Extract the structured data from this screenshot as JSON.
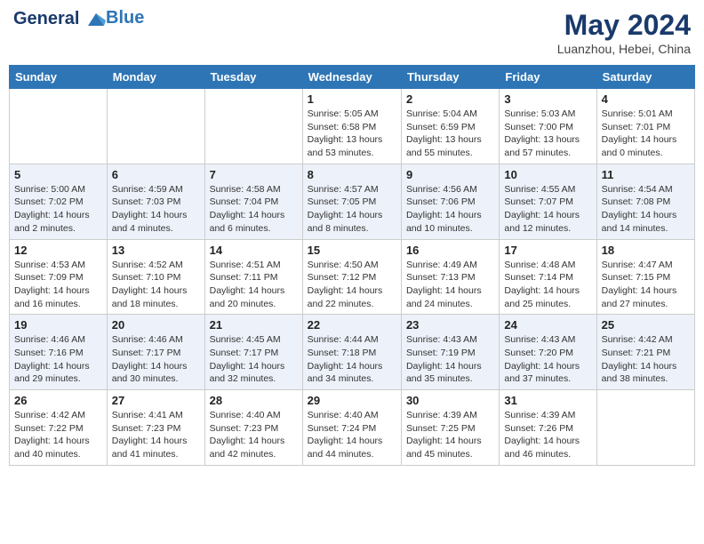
{
  "header": {
    "logo_line1": "General",
    "logo_line2": "Blue",
    "month": "May 2024",
    "location": "Luanzhou, Hebei, China"
  },
  "weekdays": [
    "Sunday",
    "Monday",
    "Tuesday",
    "Wednesday",
    "Thursday",
    "Friday",
    "Saturday"
  ],
  "weeks": [
    [
      {
        "day": "",
        "sunrise": "",
        "sunset": "",
        "daylight": ""
      },
      {
        "day": "",
        "sunrise": "",
        "sunset": "",
        "daylight": ""
      },
      {
        "day": "",
        "sunrise": "",
        "sunset": "",
        "daylight": ""
      },
      {
        "day": "1",
        "sunrise": "Sunrise: 5:05 AM",
        "sunset": "Sunset: 6:58 PM",
        "daylight": "Daylight: 13 hours and 53 minutes."
      },
      {
        "day": "2",
        "sunrise": "Sunrise: 5:04 AM",
        "sunset": "Sunset: 6:59 PM",
        "daylight": "Daylight: 13 hours and 55 minutes."
      },
      {
        "day": "3",
        "sunrise": "Sunrise: 5:03 AM",
        "sunset": "Sunset: 7:00 PM",
        "daylight": "Daylight: 13 hours and 57 minutes."
      },
      {
        "day": "4",
        "sunrise": "Sunrise: 5:01 AM",
        "sunset": "Sunset: 7:01 PM",
        "daylight": "Daylight: 14 hours and 0 minutes."
      }
    ],
    [
      {
        "day": "5",
        "sunrise": "Sunrise: 5:00 AM",
        "sunset": "Sunset: 7:02 PM",
        "daylight": "Daylight: 14 hours and 2 minutes."
      },
      {
        "day": "6",
        "sunrise": "Sunrise: 4:59 AM",
        "sunset": "Sunset: 7:03 PM",
        "daylight": "Daylight: 14 hours and 4 minutes."
      },
      {
        "day": "7",
        "sunrise": "Sunrise: 4:58 AM",
        "sunset": "Sunset: 7:04 PM",
        "daylight": "Daylight: 14 hours and 6 minutes."
      },
      {
        "day": "8",
        "sunrise": "Sunrise: 4:57 AM",
        "sunset": "Sunset: 7:05 PM",
        "daylight": "Daylight: 14 hours and 8 minutes."
      },
      {
        "day": "9",
        "sunrise": "Sunrise: 4:56 AM",
        "sunset": "Sunset: 7:06 PM",
        "daylight": "Daylight: 14 hours and 10 minutes."
      },
      {
        "day": "10",
        "sunrise": "Sunrise: 4:55 AM",
        "sunset": "Sunset: 7:07 PM",
        "daylight": "Daylight: 14 hours and 12 minutes."
      },
      {
        "day": "11",
        "sunrise": "Sunrise: 4:54 AM",
        "sunset": "Sunset: 7:08 PM",
        "daylight": "Daylight: 14 hours and 14 minutes."
      }
    ],
    [
      {
        "day": "12",
        "sunrise": "Sunrise: 4:53 AM",
        "sunset": "Sunset: 7:09 PM",
        "daylight": "Daylight: 14 hours and 16 minutes."
      },
      {
        "day": "13",
        "sunrise": "Sunrise: 4:52 AM",
        "sunset": "Sunset: 7:10 PM",
        "daylight": "Daylight: 14 hours and 18 minutes."
      },
      {
        "day": "14",
        "sunrise": "Sunrise: 4:51 AM",
        "sunset": "Sunset: 7:11 PM",
        "daylight": "Daylight: 14 hours and 20 minutes."
      },
      {
        "day": "15",
        "sunrise": "Sunrise: 4:50 AM",
        "sunset": "Sunset: 7:12 PM",
        "daylight": "Daylight: 14 hours and 22 minutes."
      },
      {
        "day": "16",
        "sunrise": "Sunrise: 4:49 AM",
        "sunset": "Sunset: 7:13 PM",
        "daylight": "Daylight: 14 hours and 24 minutes."
      },
      {
        "day": "17",
        "sunrise": "Sunrise: 4:48 AM",
        "sunset": "Sunset: 7:14 PM",
        "daylight": "Daylight: 14 hours and 25 minutes."
      },
      {
        "day": "18",
        "sunrise": "Sunrise: 4:47 AM",
        "sunset": "Sunset: 7:15 PM",
        "daylight": "Daylight: 14 hours and 27 minutes."
      }
    ],
    [
      {
        "day": "19",
        "sunrise": "Sunrise: 4:46 AM",
        "sunset": "Sunset: 7:16 PM",
        "daylight": "Daylight: 14 hours and 29 minutes."
      },
      {
        "day": "20",
        "sunrise": "Sunrise: 4:46 AM",
        "sunset": "Sunset: 7:17 PM",
        "daylight": "Daylight: 14 hours and 30 minutes."
      },
      {
        "day": "21",
        "sunrise": "Sunrise: 4:45 AM",
        "sunset": "Sunset: 7:17 PM",
        "daylight": "Daylight: 14 hours and 32 minutes."
      },
      {
        "day": "22",
        "sunrise": "Sunrise: 4:44 AM",
        "sunset": "Sunset: 7:18 PM",
        "daylight": "Daylight: 14 hours and 34 minutes."
      },
      {
        "day": "23",
        "sunrise": "Sunrise: 4:43 AM",
        "sunset": "Sunset: 7:19 PM",
        "daylight": "Daylight: 14 hours and 35 minutes."
      },
      {
        "day": "24",
        "sunrise": "Sunrise: 4:43 AM",
        "sunset": "Sunset: 7:20 PM",
        "daylight": "Daylight: 14 hours and 37 minutes."
      },
      {
        "day": "25",
        "sunrise": "Sunrise: 4:42 AM",
        "sunset": "Sunset: 7:21 PM",
        "daylight": "Daylight: 14 hours and 38 minutes."
      }
    ],
    [
      {
        "day": "26",
        "sunrise": "Sunrise: 4:42 AM",
        "sunset": "Sunset: 7:22 PM",
        "daylight": "Daylight: 14 hours and 40 minutes."
      },
      {
        "day": "27",
        "sunrise": "Sunrise: 4:41 AM",
        "sunset": "Sunset: 7:23 PM",
        "daylight": "Daylight: 14 hours and 41 minutes."
      },
      {
        "day": "28",
        "sunrise": "Sunrise: 4:40 AM",
        "sunset": "Sunset: 7:23 PM",
        "daylight": "Daylight: 14 hours and 42 minutes."
      },
      {
        "day": "29",
        "sunrise": "Sunrise: 4:40 AM",
        "sunset": "Sunset: 7:24 PM",
        "daylight": "Daylight: 14 hours and 44 minutes."
      },
      {
        "day": "30",
        "sunrise": "Sunrise: 4:39 AM",
        "sunset": "Sunset: 7:25 PM",
        "daylight": "Daylight: 14 hours and 45 minutes."
      },
      {
        "day": "31",
        "sunrise": "Sunrise: 4:39 AM",
        "sunset": "Sunset: 7:26 PM",
        "daylight": "Daylight: 14 hours and 46 minutes."
      },
      {
        "day": "",
        "sunrise": "",
        "sunset": "",
        "daylight": ""
      }
    ]
  ]
}
